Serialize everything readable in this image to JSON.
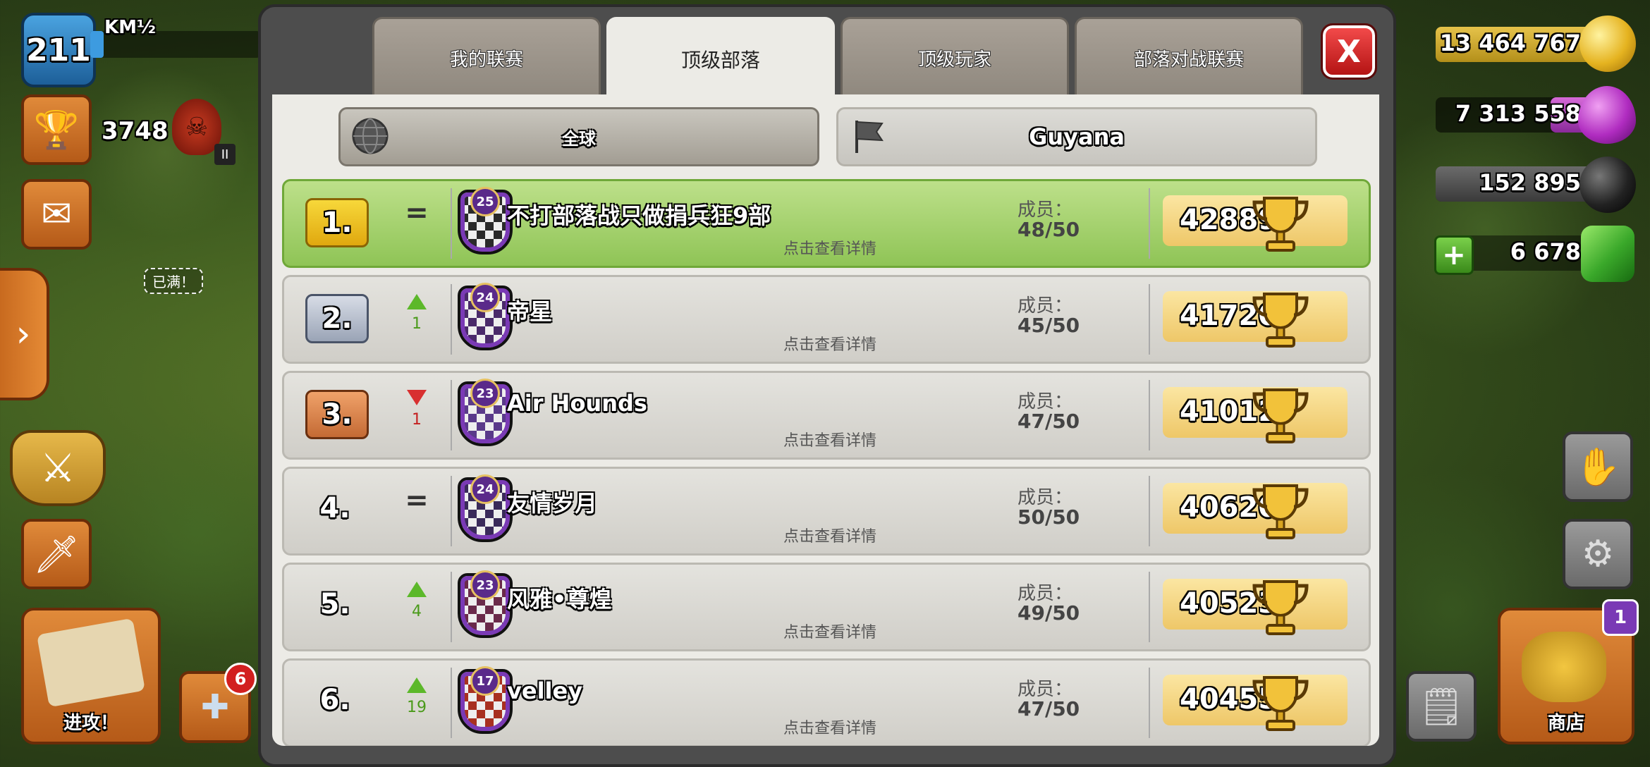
{
  "hud": {
    "level": "211",
    "player_name": "KM½",
    "xp_fraction": 0.08,
    "trophies": "3748",
    "full_label": "已满！",
    "attack_label": "进攻！",
    "shield_notification": "6",
    "shop_label": "商店",
    "shop_badge": "1"
  },
  "resources": {
    "gold": "13 464 767",
    "elixir": "7 313 558",
    "dark_elixir": "152 895",
    "gems": "6 678"
  },
  "modal": {
    "tabs": [
      {
        "label": "我的联赛",
        "active": false
      },
      {
        "label": "顶级部落",
        "active": true
      },
      {
        "label": "顶级玩家",
        "active": false
      },
      {
        "label": "部落对战联赛",
        "active": false
      }
    ],
    "close_label": "X",
    "filters": {
      "global": "全球",
      "local": "Guyana"
    },
    "members_label": "成员：",
    "detail_hint": "点击查看详情",
    "rows": [
      {
        "rank": "1.",
        "trend": "=",
        "trend_num": "",
        "badge_level": "25",
        "name": "不打部落战只做捐兵狂9部",
        "members": "48/50",
        "score": "42889"
      },
      {
        "rank": "2.",
        "trend": "up",
        "trend_num": "1",
        "badge_level": "24",
        "name": "帝星",
        "members": "45/50",
        "score": "41720"
      },
      {
        "rank": "3.",
        "trend": "down",
        "trend_num": "1",
        "badge_level": "23",
        "name": "Air Hounds",
        "members": "47/50",
        "score": "41012"
      },
      {
        "rank": "4.",
        "trend": "=",
        "trend_num": "",
        "badge_level": "24",
        "name": "友情岁月",
        "members": "50/50",
        "score": "40620"
      },
      {
        "rank": "5.",
        "trend": "up",
        "trend_num": "4",
        "badge_level": "23",
        "name": "风雅•尊煌",
        "members": "49/50",
        "score": "40523"
      },
      {
        "rank": "6.",
        "trend": "up",
        "trend_num": "19",
        "badge_level": "17",
        "name": "velley",
        "members": "47/50",
        "score": "40455"
      }
    ]
  }
}
